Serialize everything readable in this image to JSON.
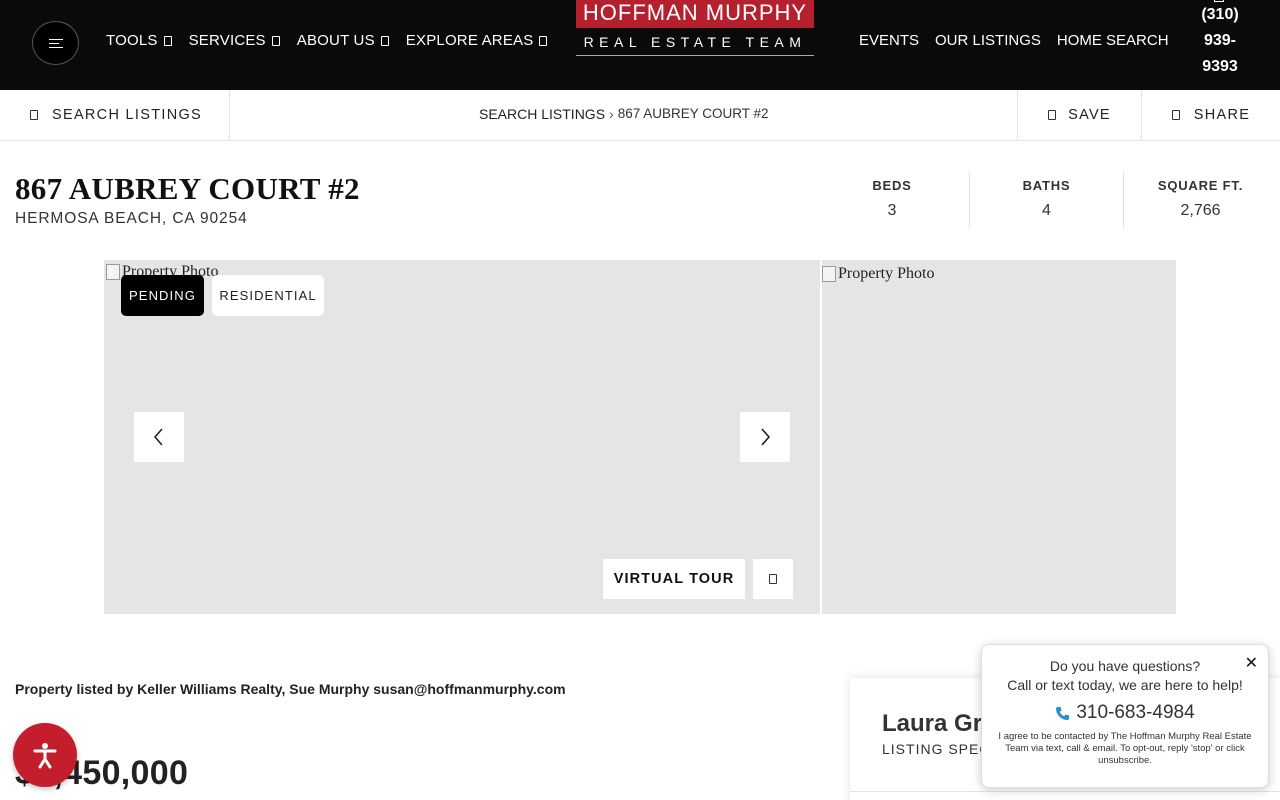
{
  "header": {
    "nav_left": [
      {
        "label": "TOOLS"
      },
      {
        "label": "SERVICES"
      },
      {
        "label": "ABOUT US"
      },
      {
        "label": "EXPLORE AREAS"
      }
    ],
    "logo_top": "HOFFMAN MURPHY",
    "logo_bottom": "REAL ESTATE TEAM",
    "nav_right": [
      "EVENTS",
      "OUR LISTINGS",
      "HOME SEARCH"
    ],
    "phone_lines": [
      "(310)",
      "939-",
      "9393"
    ]
  },
  "subnav": {
    "search_listings": "SEARCH LISTINGS",
    "breadcrumb_root": "SEARCH LISTINGS",
    "breadcrumb_sep": "›",
    "breadcrumb_current": "867 AUBREY COURT #2",
    "save": "SAVE",
    "share": "SHARE"
  },
  "property": {
    "title": "867 AUBREY COURT #2",
    "location": "HERMOSA BEACH, CA 90254",
    "stats": [
      {
        "label": "BEDS",
        "value": "3"
      },
      {
        "label": "BATHS",
        "value": "4"
      },
      {
        "label": "SQUARE FT.",
        "value": "2,766"
      }
    ]
  },
  "gallery": {
    "main_alt": "Property Photo",
    "side_alt": "Property Photo",
    "badge_status": "PENDING",
    "badge_type": "RESIDENTIAL",
    "virtual_tour": "VIRTUAL TOUR"
  },
  "listing": {
    "listed_by": "Property listed by Keller Williams Realty, Sue Murphy susan@hoffmanmurphy.com",
    "price": "$4,450,000"
  },
  "agent": {
    "name": "Laura Gr",
    "role": "LISTING SPEC"
  },
  "chat": {
    "question": "Do you have questions?",
    "subtext": "Call or text today, we are here to help!",
    "phone": "310-683-4984",
    "disclaimer": "I agree to be contacted by The Hoffman Murphy Real Estate Team via text, call & email. To opt-out, reply 'stop' or click unsubscribe.",
    "close": "✕"
  },
  "colors": {
    "header_bg": "#0a0a0a",
    "brand_red": "#b5202e",
    "accessibility_red": "#c41e2c",
    "phone_blue": "#2a8fd0"
  },
  "icons": {
    "menu": "hamburger-icon",
    "prev": "chevron-left-icon",
    "next": "chevron-right-icon",
    "accessibility": "accessibility-icon",
    "phone": "phone-icon"
  }
}
